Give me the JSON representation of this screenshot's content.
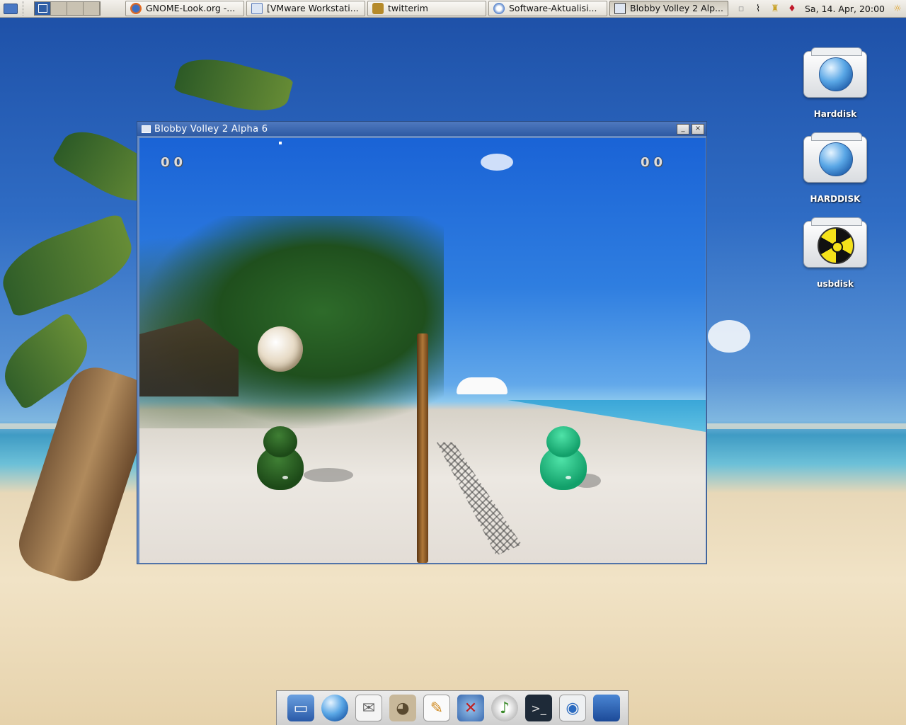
{
  "panel": {
    "tasks": [
      {
        "label": "GNOME-Look.org -...",
        "icon": "firefox-icon",
        "color": "#e86a1c"
      },
      {
        "label": "[VMware Workstati...",
        "icon": "vmware-icon",
        "color": "#5a7ab8"
      },
      {
        "label": "twitterim",
        "icon": "twitterim-icon",
        "color": "#b58a2a"
      },
      {
        "label": "Software-Aktualisi...",
        "icon": "update-manager-icon",
        "color": "#4a7ac8"
      },
      {
        "label": "Blobby Volley 2 Alp...",
        "icon": "window-icon",
        "color": "#dfe6f2"
      }
    ],
    "clock": "Sa, 14. Apr, 20:00"
  },
  "desktop_icons": [
    {
      "label": "Harddisk",
      "icon": "harddisk-icon"
    },
    {
      "label": "HARDDISK",
      "icon": "harddisk-icon"
    },
    {
      "label": "usbdisk",
      "icon": "usb-radioactive-icon"
    }
  ],
  "window": {
    "title": "Blobby Volley 2 Alpha 6",
    "minimize_glyph": "_",
    "close_glyph": "×"
  },
  "game": {
    "score_left": "00",
    "score_right": "00",
    "left_blob_color": "#1d4a18",
    "right_blob_color": "#12a06a"
  },
  "dock": {
    "items": [
      "computer-icon",
      "web-browser-icon",
      "mail-icon",
      "gimp-icon",
      "text-editor-icon",
      "system-tools-icon",
      "music-player-icon",
      "terminal-icon",
      "network-file-icon",
      "trash-icon"
    ]
  }
}
